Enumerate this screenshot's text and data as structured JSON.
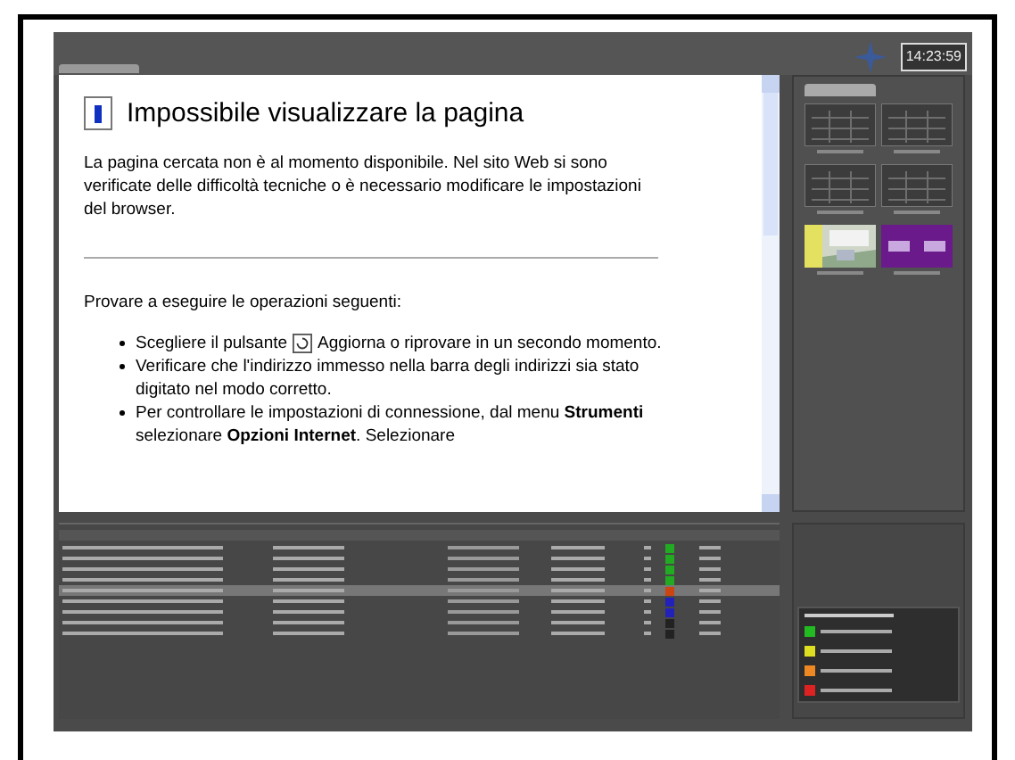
{
  "clock": "14:23:59",
  "error_page": {
    "title": "Impossibile visualizzare la pagina",
    "intro": "La pagina cercata non è al momento disponibile. Nel sito Web si sono verificate delle difficoltà tecniche o è necessario modificare le impostazioni del browser.",
    "prompt": "Provare a eseguire le operazioni seguenti:",
    "bullets": [
      {
        "before": "Scegliere il pulsante",
        "has_icon": true,
        "after": "Aggiorna o riprovare in un secondo momento."
      },
      {
        "before": "Verificare che l'indirizzo immesso nella barra degli indirizzi sia stato digitato nel modo corretto.",
        "has_icon": false
      },
      {
        "before": "Per controllare le impostazioni di connessione, dal menu **Strumenti** selezionare **Opzioni Internet**. Selezionare",
        "has_icon": false
      }
    ]
  },
  "thumbnails": [
    {
      "kind": "plain"
    },
    {
      "kind": "plain"
    },
    {
      "kind": "plain"
    },
    {
      "kind": "plain"
    },
    {
      "kind": "picture"
    },
    {
      "kind": "purple"
    }
  ],
  "rows": [
    {
      "selected": false,
      "color": "#22aa22"
    },
    {
      "selected": false,
      "color": "#22aa22"
    },
    {
      "selected": false,
      "color": "#22aa22"
    },
    {
      "selected": false,
      "color": "#22aa22"
    },
    {
      "selected": true,
      "color": "#cc4411"
    },
    {
      "selected": false,
      "color": "#2222bb"
    },
    {
      "selected": false,
      "color": "#2222bb"
    },
    {
      "selected": false,
      "color": "#222222"
    },
    {
      "selected": false,
      "color": "#222222"
    }
  ],
  "legend": [
    {
      "color": "#22bb22"
    },
    {
      "color": "#dddd22"
    },
    {
      "color": "#ee8822"
    },
    {
      "color": "#dd2222"
    }
  ]
}
